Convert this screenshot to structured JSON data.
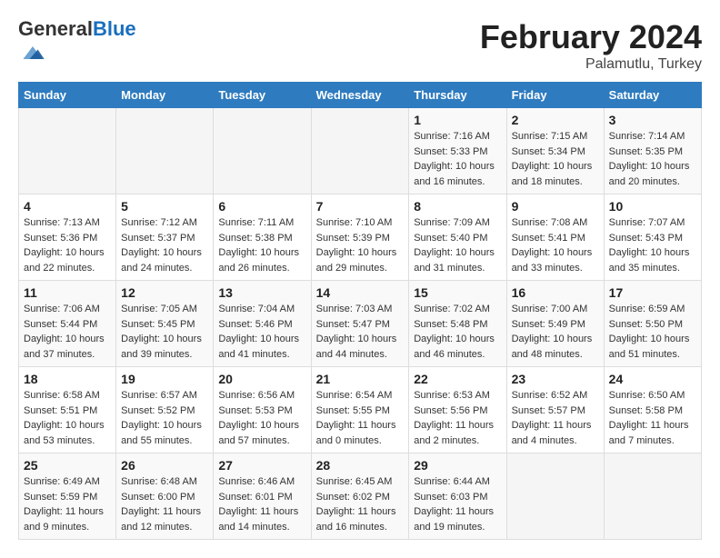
{
  "logo": {
    "general": "General",
    "blue": "Blue"
  },
  "header": {
    "month": "February 2024",
    "location": "Palamutlu, Turkey"
  },
  "weekdays": [
    "Sunday",
    "Monday",
    "Tuesday",
    "Wednesday",
    "Thursday",
    "Friday",
    "Saturday"
  ],
  "weeks": [
    [
      {
        "day": "",
        "info": ""
      },
      {
        "day": "",
        "info": ""
      },
      {
        "day": "",
        "info": ""
      },
      {
        "day": "",
        "info": ""
      },
      {
        "day": "1",
        "info": "Sunrise: 7:16 AM\nSunset: 5:33 PM\nDaylight: 10 hours\nand 16 minutes."
      },
      {
        "day": "2",
        "info": "Sunrise: 7:15 AM\nSunset: 5:34 PM\nDaylight: 10 hours\nand 18 minutes."
      },
      {
        "day": "3",
        "info": "Sunrise: 7:14 AM\nSunset: 5:35 PM\nDaylight: 10 hours\nand 20 minutes."
      }
    ],
    [
      {
        "day": "4",
        "info": "Sunrise: 7:13 AM\nSunset: 5:36 PM\nDaylight: 10 hours\nand 22 minutes."
      },
      {
        "day": "5",
        "info": "Sunrise: 7:12 AM\nSunset: 5:37 PM\nDaylight: 10 hours\nand 24 minutes."
      },
      {
        "day": "6",
        "info": "Sunrise: 7:11 AM\nSunset: 5:38 PM\nDaylight: 10 hours\nand 26 minutes."
      },
      {
        "day": "7",
        "info": "Sunrise: 7:10 AM\nSunset: 5:39 PM\nDaylight: 10 hours\nand 29 minutes."
      },
      {
        "day": "8",
        "info": "Sunrise: 7:09 AM\nSunset: 5:40 PM\nDaylight: 10 hours\nand 31 minutes."
      },
      {
        "day": "9",
        "info": "Sunrise: 7:08 AM\nSunset: 5:41 PM\nDaylight: 10 hours\nand 33 minutes."
      },
      {
        "day": "10",
        "info": "Sunrise: 7:07 AM\nSunset: 5:43 PM\nDaylight: 10 hours\nand 35 minutes."
      }
    ],
    [
      {
        "day": "11",
        "info": "Sunrise: 7:06 AM\nSunset: 5:44 PM\nDaylight: 10 hours\nand 37 minutes."
      },
      {
        "day": "12",
        "info": "Sunrise: 7:05 AM\nSunset: 5:45 PM\nDaylight: 10 hours\nand 39 minutes."
      },
      {
        "day": "13",
        "info": "Sunrise: 7:04 AM\nSunset: 5:46 PM\nDaylight: 10 hours\nand 41 minutes."
      },
      {
        "day": "14",
        "info": "Sunrise: 7:03 AM\nSunset: 5:47 PM\nDaylight: 10 hours\nand 44 minutes."
      },
      {
        "day": "15",
        "info": "Sunrise: 7:02 AM\nSunset: 5:48 PM\nDaylight: 10 hours\nand 46 minutes."
      },
      {
        "day": "16",
        "info": "Sunrise: 7:00 AM\nSunset: 5:49 PM\nDaylight: 10 hours\nand 48 minutes."
      },
      {
        "day": "17",
        "info": "Sunrise: 6:59 AM\nSunset: 5:50 PM\nDaylight: 10 hours\nand 51 minutes."
      }
    ],
    [
      {
        "day": "18",
        "info": "Sunrise: 6:58 AM\nSunset: 5:51 PM\nDaylight: 10 hours\nand 53 minutes."
      },
      {
        "day": "19",
        "info": "Sunrise: 6:57 AM\nSunset: 5:52 PM\nDaylight: 10 hours\nand 55 minutes."
      },
      {
        "day": "20",
        "info": "Sunrise: 6:56 AM\nSunset: 5:53 PM\nDaylight: 10 hours\nand 57 minutes."
      },
      {
        "day": "21",
        "info": "Sunrise: 6:54 AM\nSunset: 5:55 PM\nDaylight: 11 hours\nand 0 minutes."
      },
      {
        "day": "22",
        "info": "Sunrise: 6:53 AM\nSunset: 5:56 PM\nDaylight: 11 hours\nand 2 minutes."
      },
      {
        "day": "23",
        "info": "Sunrise: 6:52 AM\nSunset: 5:57 PM\nDaylight: 11 hours\nand 4 minutes."
      },
      {
        "day": "24",
        "info": "Sunrise: 6:50 AM\nSunset: 5:58 PM\nDaylight: 11 hours\nand 7 minutes."
      }
    ],
    [
      {
        "day": "25",
        "info": "Sunrise: 6:49 AM\nSunset: 5:59 PM\nDaylight: 11 hours\nand 9 minutes."
      },
      {
        "day": "26",
        "info": "Sunrise: 6:48 AM\nSunset: 6:00 PM\nDaylight: 11 hours\nand 12 minutes."
      },
      {
        "day": "27",
        "info": "Sunrise: 6:46 AM\nSunset: 6:01 PM\nDaylight: 11 hours\nand 14 minutes."
      },
      {
        "day": "28",
        "info": "Sunrise: 6:45 AM\nSunset: 6:02 PM\nDaylight: 11 hours\nand 16 minutes."
      },
      {
        "day": "29",
        "info": "Sunrise: 6:44 AM\nSunset: 6:03 PM\nDaylight: 11 hours\nand 19 minutes."
      },
      {
        "day": "",
        "info": ""
      },
      {
        "day": "",
        "info": ""
      }
    ]
  ]
}
